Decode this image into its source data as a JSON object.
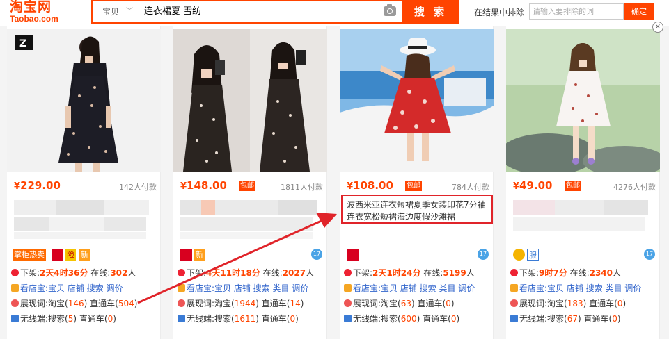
{
  "header": {
    "logo_cn": "淘宝网",
    "logo_en": "Taobao.com",
    "scope_label": "宝贝",
    "query": "连衣裙夏 雪纺",
    "search_label": "搜 索",
    "exclude_label": "在结果中排除",
    "exclude_placeholder": "请输入要排除的词",
    "exclude_button": "确定",
    "close": "×"
  },
  "products": [
    {
      "price_symbol": "¥",
      "price": "229.00",
      "baoyou": "",
      "sold": "142人付款",
      "tags": [
        "掌柜热卖",
        "",
        "险",
        "新"
      ],
      "offline_prefix": "下架:",
      "offline_time": "2天4时36分",
      "online_prefix": " 在线:",
      "online_count": "302",
      "online_suffix": "人",
      "links": "看店宝:宝贝 店铺 搜索 调价",
      "exposure_prefix": "展现词:淘宝(",
      "exposure_count": "146",
      "ztc_prefix": ") 直通车(",
      "ztc_count": "504",
      "wireless_prefix": "无线端:搜索(",
      "wireless_count": "5",
      "wireless_ztc_prefix": ") 直通车(",
      "wireless_ztc_count": "0"
    },
    {
      "price_symbol": "¥",
      "price": "148.00",
      "baoyou": "包邮",
      "sold": "1811人付款",
      "tags": [
        "",
        "新"
      ],
      "offline_prefix": "下架:",
      "offline_time": "4天11时18分",
      "online_prefix": " 在线:",
      "online_count": "2027",
      "online_suffix": "人",
      "links": "看店宝:宝贝 店铺 搜索 类目 调价",
      "exposure_prefix": "展现词:淘宝(",
      "exposure_count": "1944",
      "ztc_prefix": ") 直通车(",
      "ztc_count": "14",
      "wireless_prefix": "无线端:搜索(",
      "wireless_count": "1611",
      "wireless_ztc_prefix": ") 直通车(",
      "wireless_ztc_count": "0"
    },
    {
      "price_symbol": "¥",
      "price": "108.00",
      "baoyou": "包邮",
      "sold": "784人付款",
      "tags": [
        ""
      ],
      "offline_prefix": "下架:",
      "offline_time": "2天1时24分",
      "online_prefix": " 在线:",
      "online_count": "5199",
      "online_suffix": "人",
      "links": "看店宝:宝贝 店铺 搜索 类目 调价",
      "exposure_prefix": "展现词:淘宝(",
      "exposure_count": "63",
      "ztc_prefix": ") 直通车(",
      "ztc_count": "0",
      "wireless_prefix": "无线端:搜索(",
      "wireless_count": "600",
      "wireless_ztc_prefix": ") 直通车(",
      "wireless_ztc_count": "0"
    },
    {
      "price_symbol": "¥",
      "price": "49.00",
      "baoyou": "包邮",
      "sold": "4276人付款",
      "tags": [
        "",
        "服"
      ],
      "offline_prefix": "下架:",
      "offline_time": "9时7分",
      "online_prefix": " 在线:",
      "online_count": "2340",
      "online_suffix": "人",
      "links": "看店宝:宝贝 店铺 搜索 类目 调价",
      "exposure_prefix": "展现词:淘宝(",
      "exposure_count": "183",
      "ztc_prefix": ") 直通车(",
      "ztc_count": "0",
      "wireless_prefix": "无线端:搜索(",
      "wireless_count": "67",
      "wireless_ztc_prefix": ") 直通车(",
      "wireless_ztc_count": "0"
    }
  ],
  "annotation": {
    "line1": "波西米亚连衣短裙夏季女装印花7分袖",
    "line2": "连衣宽松短裙海边度假沙滩裙"
  },
  "colors": {
    "accent": "#ff4400",
    "annotation_red": "#e0242a"
  }
}
